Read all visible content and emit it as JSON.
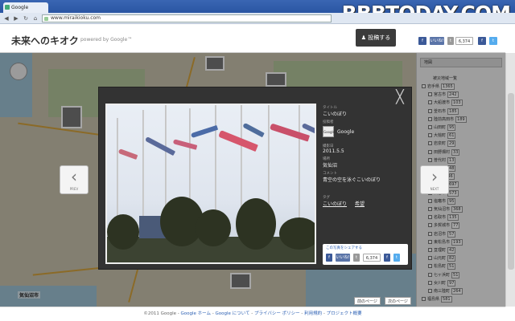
{
  "browser": {
    "tab_title": "Google",
    "url": "www.miraikioku.com",
    "watermark": "RBBTODAY.COM"
  },
  "header": {
    "logo": "未来へのキオク",
    "logo_sub": "powered by Google™",
    "post_button": "投稿する",
    "social_like": "いいね!",
    "social_count": "6,374",
    "social_fb": "f",
    "social_tw": "t"
  },
  "map": {
    "town_label": "気仙沼市"
  },
  "sidebar": {
    "header": "地図",
    "title": "被災地域一覧",
    "items": [
      {
        "label": "岩手県",
        "count": "1365"
      },
      {
        "label": "宮古市",
        "count": "242"
      },
      {
        "label": "大船渡市",
        "count": "103"
      },
      {
        "label": "釜石市",
        "count": "185"
      },
      {
        "label": "陸前高田市",
        "count": "189"
      },
      {
        "label": "山田町",
        "count": "95"
      },
      {
        "label": "大槌町",
        "count": "61"
      },
      {
        "label": "岩泉町",
        "count": "29"
      },
      {
        "label": "田野畑村",
        "count": "33"
      },
      {
        "label": "普代村",
        "count": "13"
      },
      {
        "label": "野田村",
        "count": "48"
      },
      {
        "label": "宮城県",
        "count": "2946"
      },
      {
        "label": "仙台市",
        "count": "697"
      },
      {
        "label": "石巻市",
        "count": "573"
      },
      {
        "label": "塩竈市",
        "count": "95"
      },
      {
        "label": "気仙沼市",
        "count": "368"
      },
      {
        "label": "名取市",
        "count": "135"
      },
      {
        "label": "多賀城市",
        "count": "77"
      },
      {
        "label": "岩沼市",
        "count": "57"
      },
      {
        "label": "東松島市",
        "count": "193"
      },
      {
        "label": "亘理町",
        "count": "42"
      },
      {
        "label": "山元町",
        "count": "82"
      },
      {
        "label": "松島町",
        "count": "51"
      },
      {
        "label": "七ヶ浜町",
        "count": "51"
      },
      {
        "label": "女川町",
        "count": "97"
      },
      {
        "label": "南三陸町",
        "count": "264"
      },
      {
        "label": "福島県",
        "count": "581"
      }
    ]
  },
  "modal": {
    "title_label": "タイトル",
    "title": "こいのぼり",
    "author_label": "投稿者",
    "author": "Google",
    "date_label": "撮影日",
    "date": "2011.5.5",
    "place_label": "場所",
    "place": "気仙沼",
    "desc_label": "コメント",
    "desc": "青空の空を泳ぐこいのぼり",
    "tag_label": "タグ",
    "tag1": "こいのぼり",
    "tag2": "希望",
    "share_label": "この写真をシェアする",
    "share_count": "6,374",
    "prev_label": "PREV",
    "next_label": "NEXT",
    "close": "╳"
  },
  "footer": {
    "copyright": "©2011 Google",
    "links": [
      "Google ホーム",
      "Google について",
      "プライバシー ポリシー",
      "利用規約",
      "プロジェクト概要"
    ]
  },
  "map_buttons": {
    "prev": "前のページ",
    "next": "次のページ"
  }
}
